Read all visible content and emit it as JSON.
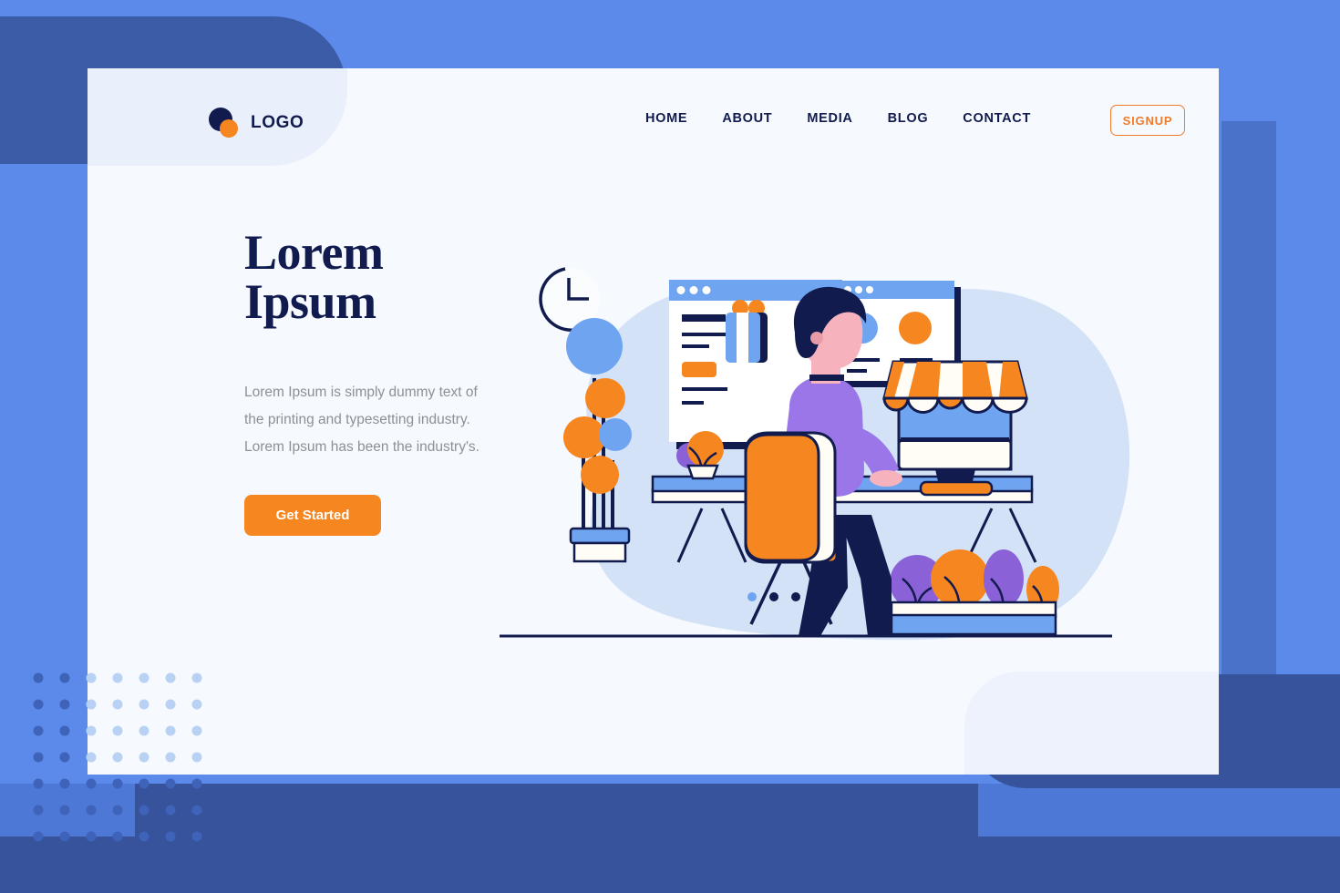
{
  "brand": {
    "logo_text": "LOGO",
    "logo_icon": "logo-circles-icon",
    "colors": {
      "navy": "#111b4e",
      "orange": "#f6861f",
      "orange_outline": "#f07c2b",
      "blue": "#5b8aea",
      "light_blue": "#6fa4f0",
      "card_bg": "#f6f9fe",
      "header_band": "#e9effb",
      "muted_text": "#8b9199",
      "dark_blue": "#36539b",
      "purple": "#8b61d8",
      "skin": "#f7b3bd"
    }
  },
  "nav": {
    "items": [
      {
        "label": "HOME"
      },
      {
        "label": "ABOUT"
      },
      {
        "label": "MEDIA"
      },
      {
        "label": "BLOG"
      },
      {
        "label": "CONTACT"
      }
    ],
    "signup_label": "SIGNUP"
  },
  "hero": {
    "title_line1": "Lorem",
    "title_line2": "Ipsum",
    "description": "Lorem Ipsum is simply dummy text of the printing and typesetting industry. Lorem Ipsum has been the industry's.",
    "cta_label": "Get Started"
  },
  "carousel": {
    "dots": [
      {
        "state": "active"
      },
      {
        "state": "inactive"
      },
      {
        "state": "inactive"
      }
    ],
    "active_index": 0,
    "total": 3
  },
  "illustration": {
    "name": "online-shopping-workspace-illustration",
    "elements": [
      "browser-window-large",
      "browser-window-small",
      "wall-clock",
      "gift-box",
      "abstract-plant-stand",
      "desk",
      "office-chair",
      "seated-man",
      "monitor-with-shop-awning",
      "potted-plant",
      "planter-box"
    ]
  }
}
